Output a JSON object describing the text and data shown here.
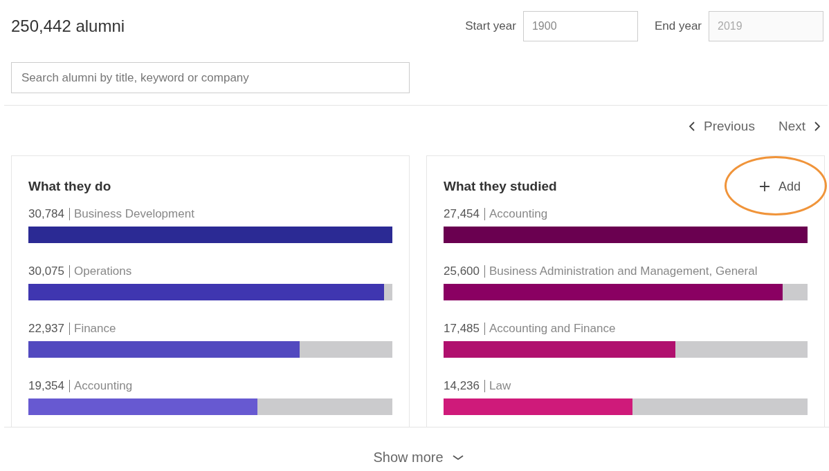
{
  "header": {
    "title": "250,442 alumni",
    "year_fields": [
      {
        "label": "Start year",
        "value": "1900"
      },
      {
        "label": "End year",
        "value": "2019"
      }
    ]
  },
  "search": {
    "placeholder": "Search alumni by title, keyword or company"
  },
  "pager": {
    "previous": "Previous",
    "next": "Next"
  },
  "cards": [
    {
      "title": "What they do",
      "rows": [
        {
          "count": "30,784",
          "label": "Business Development",
          "level": 1,
          "color": "#2b2a94"
        },
        {
          "count": "30,075",
          "label": "Operations",
          "level": 0.977,
          "color": "#3f36b0"
        },
        {
          "count": "22,937",
          "label": "Finance",
          "level": 0.745,
          "color": "#5249bf"
        },
        {
          "count": "19,354",
          "label": "Accounting",
          "level": 0.629,
          "color": "#6759d1"
        }
      ]
    },
    {
      "title": "What they studied",
      "add_button": {
        "label": "Add",
        "highlighted": true
      },
      "rows": [
        {
          "count": "27,454",
          "label": "Accounting",
          "level": 1,
          "color": "#6a0050"
        },
        {
          "count": "25,600",
          "label": "Business Administration and Management, General",
          "level": 0.932,
          "color": "#8a0062"
        },
        {
          "count": "17,485",
          "label": "Accounting and Finance",
          "level": 0.637,
          "color": "#b0106e"
        },
        {
          "count": "14,236",
          "label": "Law",
          "level": 0.519,
          "color": "#cf1a7a"
        }
      ]
    }
  ],
  "show_more": "Show more"
}
